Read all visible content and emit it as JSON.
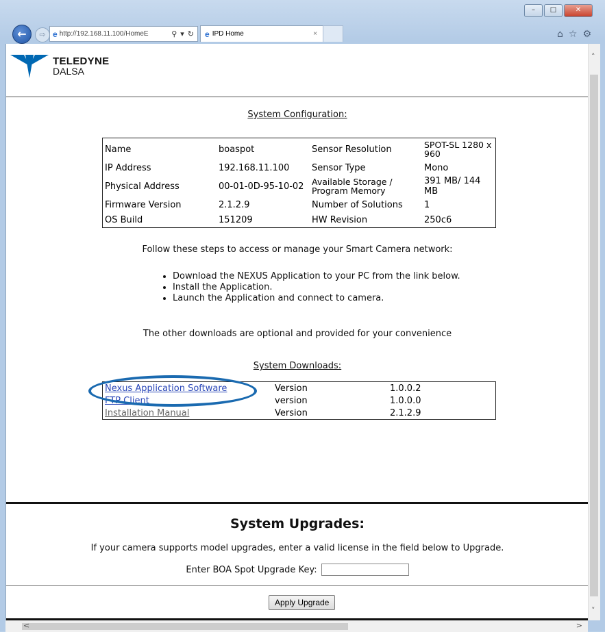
{
  "browser": {
    "url": "http://192.168.11.100/HomeE",
    "tab_title": "IPD Home",
    "tab_close": "×",
    "back_glyph": "←",
    "forward_glyph": "⇨",
    "window_buttons": [
      "–",
      "□",
      "✕"
    ],
    "icons": [
      "home-icon",
      "star-icon",
      "gear-icon"
    ]
  },
  "logo": {
    "line1": "TELEDYNE",
    "line2": "DALSA",
    "color": "#0068b3"
  },
  "config": {
    "title": "System Configuration:",
    "rows": [
      [
        "Name",
        "boaspot",
        "Sensor Resolution",
        "SPOT-SL 1280 x 960"
      ],
      [
        "IP Address",
        "192.168.11.100",
        "Sensor Type",
        "Mono"
      ],
      [
        "Physical Address",
        "00-01-0D-95-10-02",
        "Available Storage / Program Memory",
        "391 MB/ 144 MB"
      ],
      [
        "Firmware Version",
        "2.1.2.9",
        "Number of Solutions",
        "1"
      ],
      [
        "OS Build",
        "151209",
        "HW Revision",
        "250c6"
      ]
    ]
  },
  "instructions": {
    "intro": "Follow these steps to access or manage your Smart Camera network:",
    "steps": [
      "Download the NEXUS Application to your PC from the link below.",
      "Install the Application.",
      "Launch the Application and connect to camera."
    ],
    "other": "The other downloads are optional and provided for your convenience"
  },
  "downloads": {
    "title": "System Downloads:",
    "rows": [
      [
        "Nexus Application Software",
        "Version",
        "1.0.0.2"
      ],
      [
        "FTP Client",
        "version",
        "1.0.0.0"
      ],
      [
        "Installation Manual",
        "Version",
        "2.1.2.9"
      ]
    ],
    "highlight_color": "#1a6ab0"
  },
  "upgrades": {
    "title": "System Upgrades:",
    "description": "If your camera supports model upgrades, enter a valid license in the field below to Upgrade.",
    "key_label": "Enter BOA Spot Upgrade Key:",
    "key_value": "",
    "apply_label": "Apply Upgrade"
  }
}
